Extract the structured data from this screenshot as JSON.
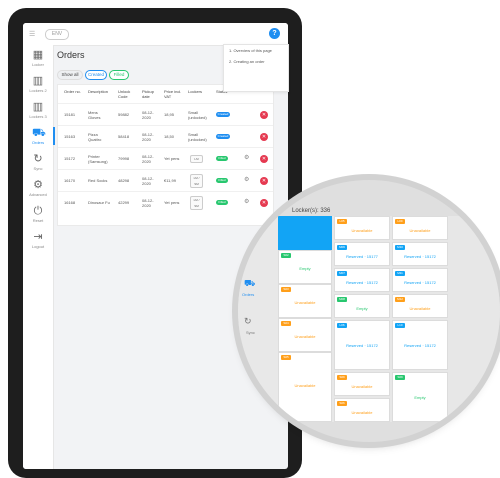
{
  "topbar": {
    "menu_glyph": "☰",
    "pill": "ENV",
    "help": "?"
  },
  "sidebar": {
    "items": [
      {
        "icon": "▦",
        "label": "Locker"
      },
      {
        "icon": "▥",
        "label": "Lockers 2"
      },
      {
        "icon": "▥",
        "label": "Lockers 3"
      },
      {
        "icon": "⛟",
        "label": "Orders"
      },
      {
        "icon": "↻",
        "label": "Sync"
      },
      {
        "icon": "⚙",
        "label": "Advanced"
      },
      {
        "icon": "⏻",
        "label": "Reset"
      },
      {
        "icon": "⇥",
        "label": "Logout"
      }
    ]
  },
  "page": {
    "title": "Orders"
  },
  "popover": {
    "items": [
      "1. Overview of this page",
      "2. Creating an order"
    ]
  },
  "filters": [
    "Show all",
    "Created",
    "Filled"
  ],
  "table": {
    "headers": [
      "Order no.",
      "Description",
      "Unlock Code",
      "Pickup date",
      "Price incl. VAT",
      "Lockers",
      "Status"
    ],
    "rows": [
      {
        "order": "15181",
        "desc": "Mens Gloves",
        "code": "59882",
        "date": "08-12-2020",
        "price": "18,95",
        "lockers": "Small (unlocked)",
        "status": "Created",
        "status_color": "#1f8ef1"
      },
      {
        "order": "15163",
        "desc": "Pizza Quattro",
        "code": "58418",
        "date": "08-12-2020",
        "price": "18,50",
        "lockers": "Small (unlocked)",
        "status": "Created",
        "status_color": "#1f8ef1"
      },
      {
        "order": "15172",
        "desc": "Printer (Samsung)",
        "code": "79998",
        "date": "08-12-2020",
        "price": "Yet pens",
        "lockers": "LM",
        "status": "Filled",
        "status_color": "#28c76f"
      },
      {
        "order": "16170",
        "desc": "Red Socks",
        "code": "48298",
        "date": "08-12-2020",
        "price": "€11,99",
        "lockers": "LM / SM",
        "status": "Filled",
        "status_color": "#28c76f"
      },
      {
        "order": "16168",
        "desc": "Dinosaur Fu",
        "code": "42299",
        "date": "08-12-2020",
        "price": "Yet pens",
        "lockers": "LM / SM",
        "status": "Filled",
        "status_color": "#28c76f"
      }
    ]
  },
  "lens": {
    "caption": "Locker(s): 336",
    "side_labels": [
      "Orders",
      "Sync"
    ],
    "tiles": [
      {
        "tag": "",
        "tag_color": "#12a4f5",
        "text": "",
        "color": "#fff",
        "blue": true
      },
      {
        "tag": "L05",
        "tag_color": "#ff9f1a",
        "text": "Unavailable",
        "color": "#ff9f1a"
      },
      {
        "tag": "L09",
        "tag_color": "#ff9f1a",
        "text": "Unavailable",
        "color": "#ff9f1a"
      },
      {
        "tag": "S02",
        "tag_color": "#28c76f",
        "text": "Empty",
        "color": "#28c76f"
      },
      {
        "tag": "M06",
        "tag_color": "#12a4f5",
        "text": "Reserved · 15177",
        "color": "#12a4f5"
      },
      {
        "tag": "M10",
        "tag_color": "#12a4f5",
        "text": "Reserved · 15172",
        "color": "#12a4f5"
      },
      {
        "tag": "S03",
        "tag_color": "#ff9f1a",
        "text": "Unavailable",
        "color": "#ff9f1a"
      },
      {
        "tag": "M07",
        "tag_color": "#12a4f5",
        "text": "Reserved · 15172",
        "color": "#12a4f5"
      },
      {
        "tag": "M11",
        "tag_color": "#12a4f5",
        "text": "Reserved · 15172",
        "color": "#12a4f5"
      },
      {
        "tag": "M08",
        "tag_color": "#28c76f",
        "text": "Empty",
        "color": "#28c76f"
      },
      {
        "tag": "M12",
        "tag_color": "#ff9f1a",
        "text": "Unavailable",
        "color": "#ff9f1a"
      },
      {
        "tag": "S04",
        "tag_color": "#ff9f1a",
        "text": "Unavailable",
        "color": "#ff9f1a"
      },
      {
        "tag": "L06",
        "tag_color": "#12a4f5",
        "text": "Reserved · 15172",
        "color": "#12a4f5"
      },
      {
        "tag": "L10",
        "tag_color": "#12a4f5",
        "text": "Reserved · 15172",
        "color": "#12a4f5"
      },
      {
        "tag": "L03",
        "tag_color": "#ff9f1a",
        "text": "Unavailable",
        "color": "#ff9f1a"
      },
      {
        "tag": "S05",
        "tag_color": "#ff9f1a",
        "text": "Unavailable",
        "color": "#ff9f1a"
      },
      {
        "tag": "S09",
        "tag_color": "#28c76f",
        "text": "Empty",
        "color": "#28c76f"
      },
      {
        "tag": "S06",
        "tag_color": "#ff9f1a",
        "text": "Unavailable",
        "color": "#ff9f1a"
      }
    ]
  }
}
